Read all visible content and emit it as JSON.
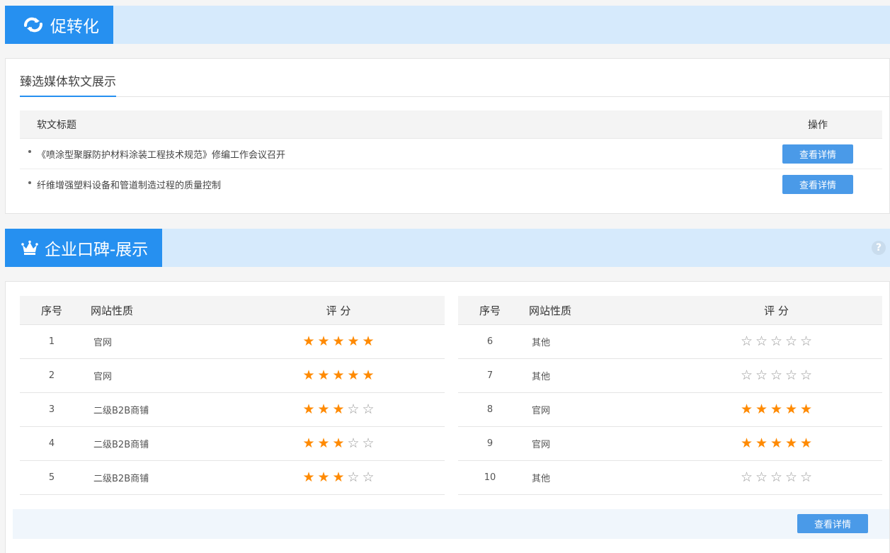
{
  "section1": {
    "title": "促转化",
    "icon": "refresh-cycle-icon",
    "subtitle": "臻选媒体软文展示",
    "header_title": "软文标题",
    "header_action": "操作",
    "articles": [
      {
        "title": "《喷涂型聚脲防护材料涂装工程技术规范》修编工作会议召开",
        "action": "查看详情"
      },
      {
        "title": "纤维增强塑料设备和管道制造过程的质量控制",
        "action": "查看详情"
      }
    ]
  },
  "section2": {
    "title": "企业口碑-展示",
    "icon": "crown-icon",
    "help": "?",
    "header_idx": "序号",
    "header_type": "网站性质",
    "header_score": "评 分",
    "left_rows": [
      {
        "idx": "1",
        "type": "官网",
        "stars": 5
      },
      {
        "idx": "2",
        "type": "官网",
        "stars": 5
      },
      {
        "idx": "3",
        "type": "二级B2B商铺",
        "stars": 3
      },
      {
        "idx": "4",
        "type": "二级B2B商铺",
        "stars": 3
      },
      {
        "idx": "5",
        "type": "二级B2B商铺",
        "stars": 3
      }
    ],
    "right_rows": [
      {
        "idx": "6",
        "type": "其他",
        "stars": 0
      },
      {
        "idx": "7",
        "type": "其他",
        "stars": 0
      },
      {
        "idx": "8",
        "type": "官网",
        "stars": 5
      },
      {
        "idx": "9",
        "type": "官网",
        "stars": 5
      },
      {
        "idx": "10",
        "type": "其他",
        "stars": 0
      }
    ],
    "max_stars": 5,
    "detail_button": "查看详情"
  },
  "colors": {
    "accent": "#2690f0",
    "banner_bg": "#d6eafc",
    "button": "#4a9ae8",
    "star_full": "#ff8a00",
    "star_empty": "#9a9a9a"
  }
}
